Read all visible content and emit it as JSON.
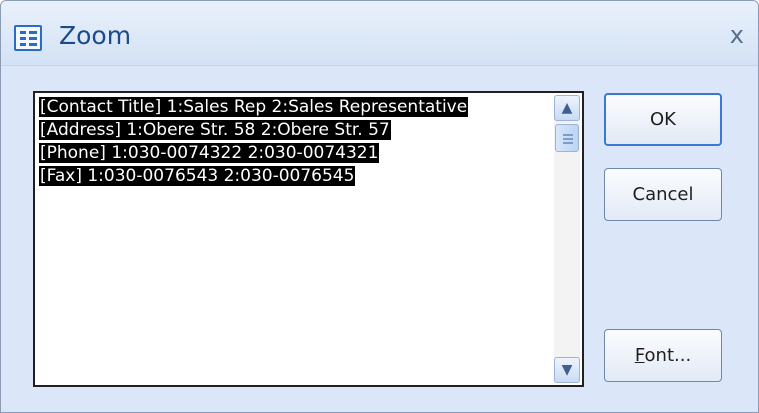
{
  "window": {
    "title": "Zoom",
    "close_glyph": "x",
    "app_icon": "form-icon"
  },
  "editor": {
    "lines": [
      "[Contact Title] 1:Sales Rep 2:Sales Representative",
      "[Address] 1:Obere Str. 58 2:Obere Str. 57",
      "[Phone] 1:030-0074322 2:030-0074321",
      "[Fax] 1:030-0076543 2:030-0076545"
    ],
    "selection": "all"
  },
  "buttons": {
    "ok_label": "OK",
    "cancel_label": "Cancel",
    "font_label_accesskey": "F",
    "font_label_rest": "ont..."
  }
}
